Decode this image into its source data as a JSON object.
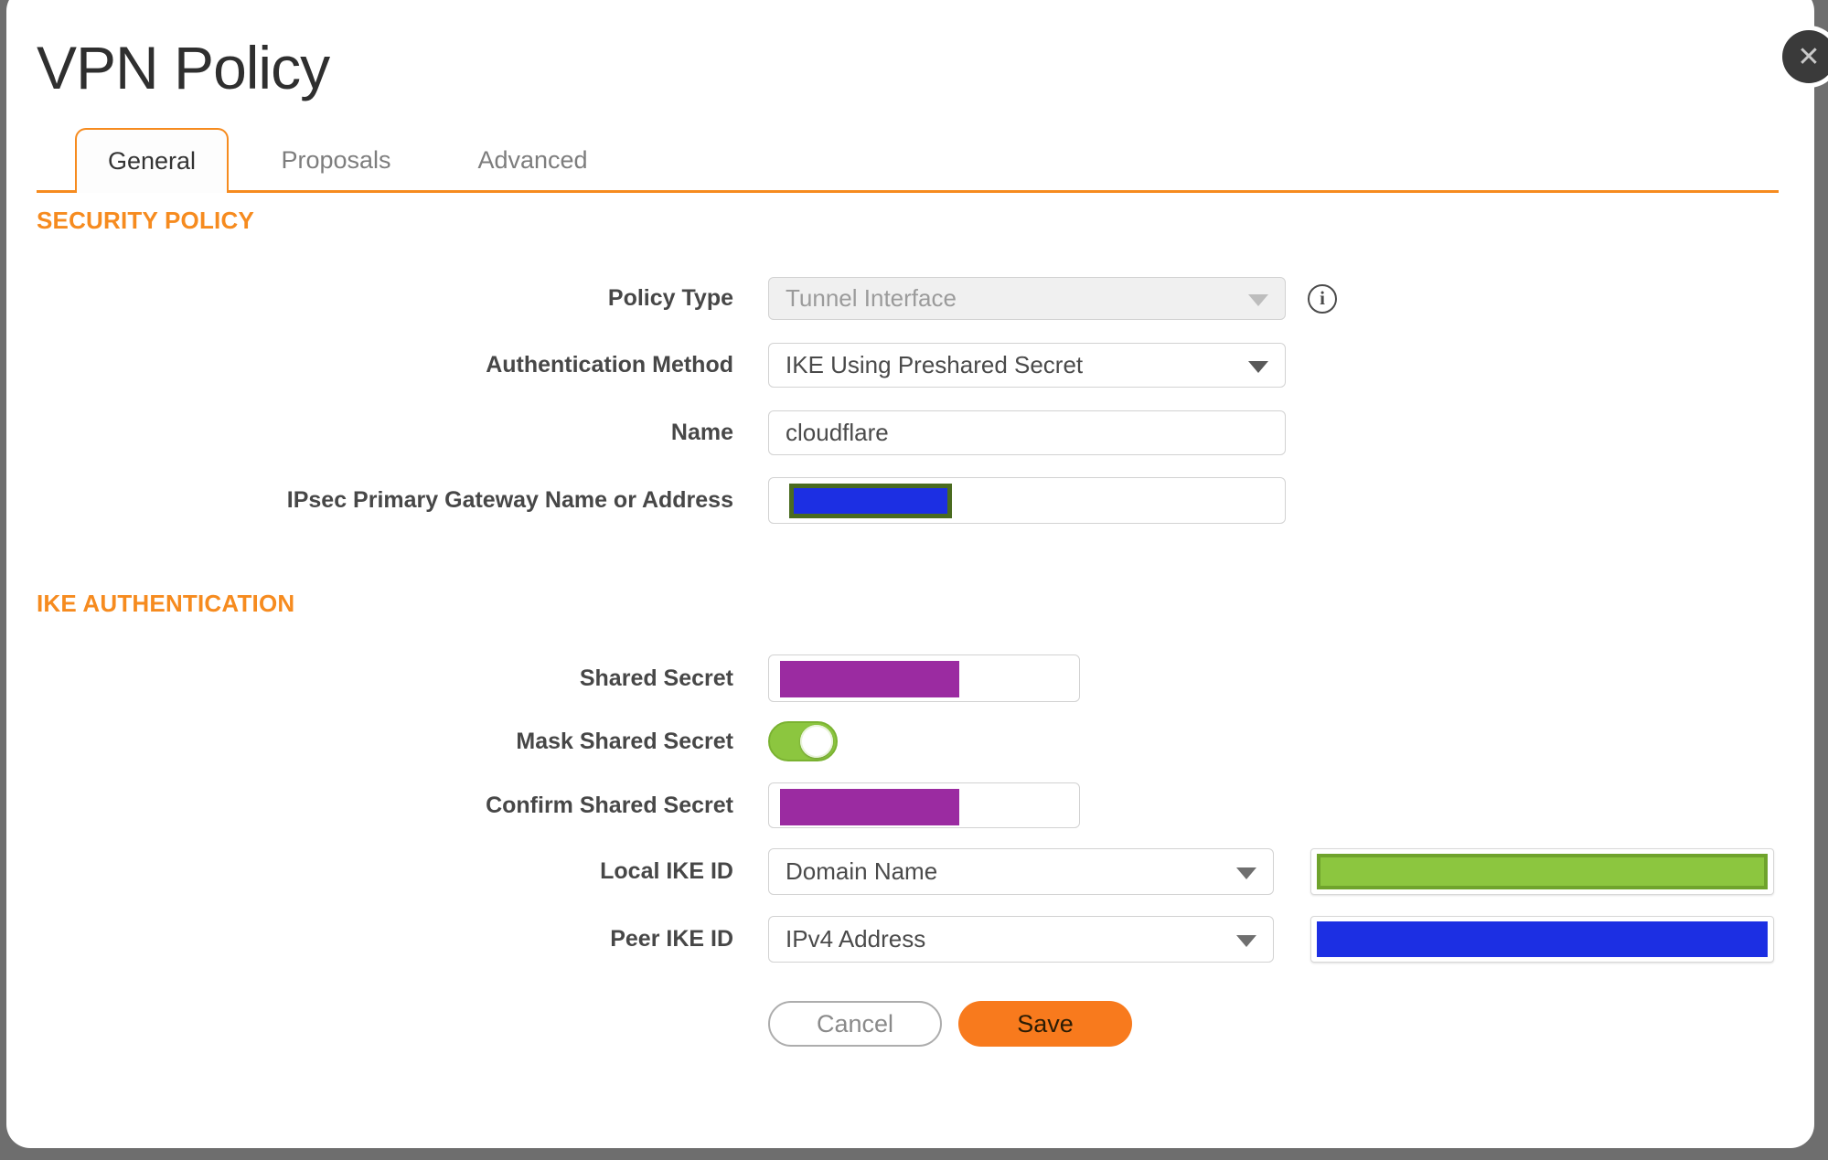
{
  "dialog": {
    "title": "VPN Policy"
  },
  "icons": {
    "close": "✕",
    "info": "i"
  },
  "tabs": [
    {
      "label": "General",
      "active": true
    },
    {
      "label": "Proposals",
      "active": false
    },
    {
      "label": "Advanced",
      "active": false
    }
  ],
  "security_policy": {
    "heading": "SECURITY POLICY",
    "policy_type": {
      "label": "Policy Type",
      "value": "Tunnel Interface",
      "disabled": true
    },
    "authentication_method": {
      "label": "Authentication Method",
      "value": "IKE Using Preshared Secret"
    },
    "name": {
      "label": "Name",
      "value": "cloudflare"
    },
    "gateway": {
      "label": "IPsec Primary Gateway Name or Address",
      "value": "",
      "redacted": true
    }
  },
  "ike_authentication": {
    "heading": "IKE AUTHENTICATION",
    "shared_secret": {
      "label": "Shared Secret",
      "redacted": true
    },
    "mask_shared_secret": {
      "label": "Mask Shared Secret",
      "state": "on"
    },
    "confirm_shared_secret": {
      "label": "Confirm Shared Secret",
      "redacted": true
    },
    "local_ike_id": {
      "label": "Local IKE ID",
      "type": "Domain Name",
      "value_redacted": true
    },
    "peer_ike_id": {
      "label": "Peer IKE ID",
      "type": "IPv4 Address",
      "value_redacted": true
    }
  },
  "actions": {
    "cancel": "Cancel",
    "save": "Save"
  },
  "colors": {
    "accent_orange": "#f68b1f",
    "save_orange": "#f87a1d",
    "toggle_green": "#8cc63f",
    "redact_purple": "#9b2ba1",
    "redact_blue": "#1c2fe3",
    "redact_green": "#8cc63f",
    "redact_olive_border": "#4a6b1f",
    "backdrop_gray": "#6e6e6e"
  }
}
